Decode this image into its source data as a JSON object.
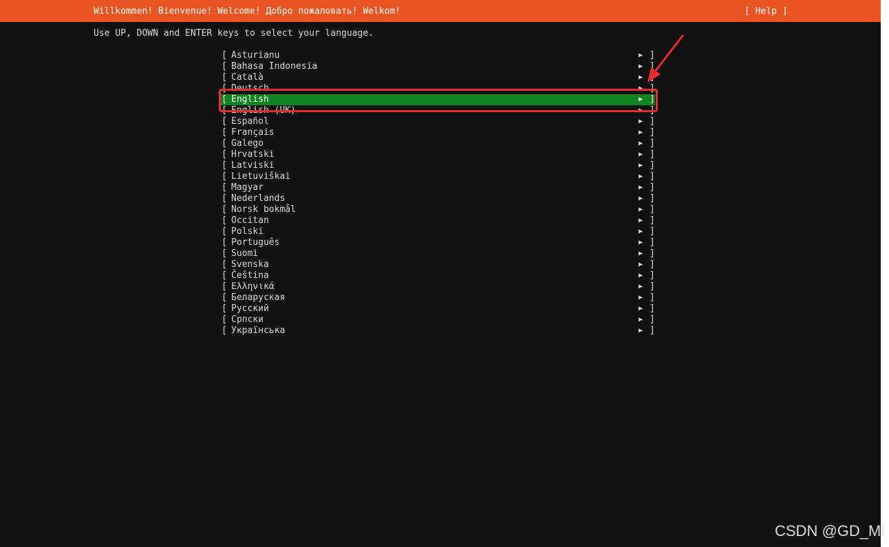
{
  "header": {
    "title": "Willkommen! Bienvenue! Welcome! Добро пожаловать! Welkom!",
    "help_label": "[ Help ]"
  },
  "instructions": "Use UP, DOWN and ENTER keys to select your language.",
  "list": {
    "open_bracket": "[",
    "close_bracket": "]",
    "arrow_glyph": "▶",
    "selected_index": 4,
    "items": [
      "Asturianu",
      "Bahasa Indonesia",
      "Català",
      "Deutsch",
      "English",
      "English (UK)",
      "Español",
      "Français",
      "Galego",
      "Hrvatski",
      "Latviski",
      "Lietuviškai",
      "Magyar",
      "Nederlands",
      "Norsk bokmål",
      "Occitan",
      "Polski",
      "Português",
      "Suomi",
      "Svenska",
      "Čeština",
      "Ελληνικά",
      "Беларуская",
      "Русский",
      "Српски",
      "Українська"
    ]
  },
  "colors": {
    "header_bg": "#e95420",
    "selected_bg": "#0e8420",
    "annotation": "#e62e2e",
    "background": "#111111"
  },
  "watermark": "CSDN @GD_MI"
}
